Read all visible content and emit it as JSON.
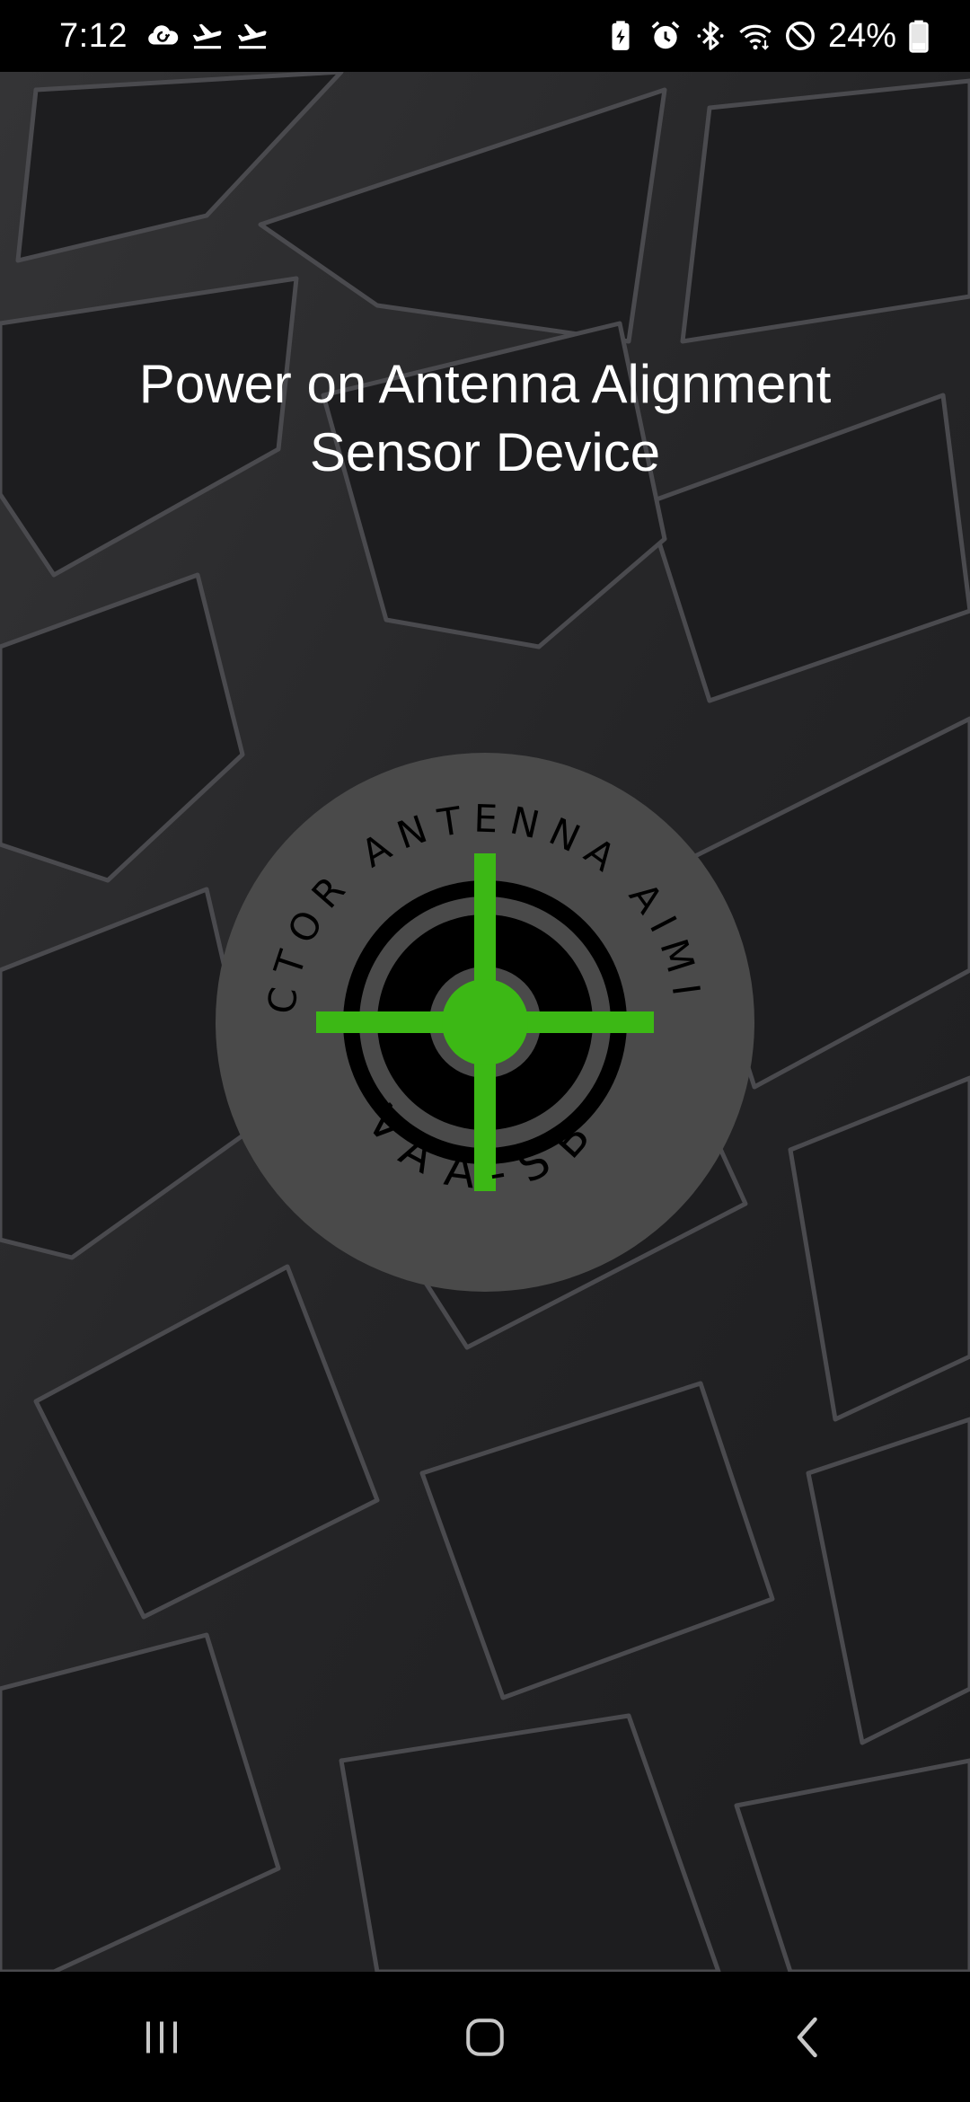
{
  "status_bar": {
    "time": "7:12",
    "battery_percent": "24%",
    "left_icons": [
      "cloud-sync-icon",
      "flight-takeoff-icon",
      "flight-takeoff-icon"
    ],
    "right_icons": [
      "battery-saver-icon",
      "alarm-icon",
      "bluetooth-icon",
      "wifi-icon",
      "do-not-disturb-icon",
      "battery-icon"
    ]
  },
  "main": {
    "headline_line1": "Power on Antenna Alignment",
    "headline_line2": "Sensor Device",
    "logo": {
      "text_top": "VECTOR ANTENNA AIMING",
      "text_bottom": "VAA-SB"
    }
  },
  "nav_bar": {
    "buttons": [
      "recent-apps-icon",
      "home-icon",
      "back-icon"
    ]
  },
  "colors": {
    "accent_green": "#3cb815",
    "logo_disc": "#4a4a4a",
    "background": "#2a2a2c",
    "text": "#ffffff"
  }
}
